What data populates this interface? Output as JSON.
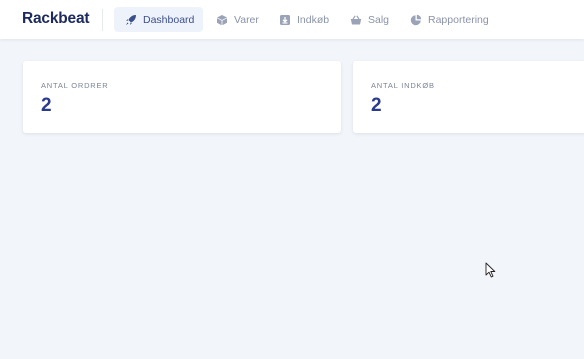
{
  "app": {
    "brand": "Rackbeat"
  },
  "nav": {
    "items": [
      {
        "label": "Dashboard",
        "icon": "rocket-icon",
        "active": true
      },
      {
        "label": "Varer",
        "icon": "box-icon",
        "active": false
      },
      {
        "label": "Indkøb",
        "icon": "download-icon",
        "active": false
      },
      {
        "label": "Salg",
        "icon": "basket-icon",
        "active": false
      },
      {
        "label": "Rapportering",
        "icon": "pie-chart-icon",
        "active": false
      }
    ]
  },
  "stats": [
    {
      "label": "ANTAL ORDRER",
      "value": "2"
    },
    {
      "label": "ANTAL INDKØB",
      "value": "2"
    }
  ],
  "colors": {
    "brand": "#1c2a5e",
    "accent": "#2a3a8c",
    "active_nav_bg": "#eef2fb",
    "page_bg": "#f2f5fa"
  }
}
